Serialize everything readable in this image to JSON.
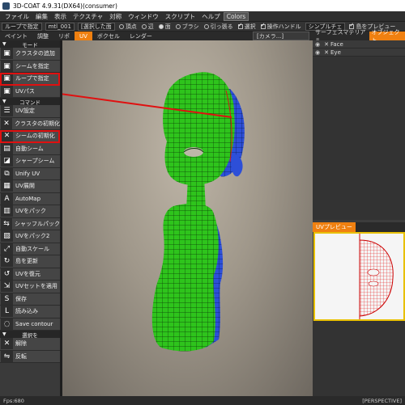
{
  "window": {
    "title": "3D-COAT 4.9.31(DX64)(consumer)"
  },
  "menu": [
    "ファイル",
    "編集",
    "表示",
    "テクスチャ",
    "対称",
    "ウィンドウ",
    "スクリプト",
    "ヘルプ",
    "Colors"
  ],
  "toolbar": {
    "mode_select": "ループで指定",
    "material": "mtl_001",
    "selected_faces": "[選択した面",
    "opt_vertex": "頂点",
    "opt_edge": "辺",
    "opt_face": "面",
    "opt_brush": "ブラシ",
    "opt_pull": "引っ張る",
    "chk_select": "選択",
    "chk_handle": "操作ハンドル",
    "simple": "シンプルチェ",
    "chk_preview": "島をプレビュー"
  },
  "tabs": {
    "paint": "ペイント",
    "sculpt": "調整",
    "retopo": "リポ",
    "uv": "UV",
    "voxel": "ボクセル",
    "render": "レンダー",
    "camera": "[カメラ...]"
  },
  "right_tabs": {
    "surface_material": "サーフェスマテリアル",
    "object": "オブジェクト"
  },
  "layers": [
    {
      "name": "Face"
    },
    {
      "name": "Eye"
    }
  ],
  "left_panel": {
    "mode_header": "モード",
    "command_header": "コマンド",
    "select_header": "選択を",
    "mode_tools": [
      {
        "label": "クラスタの追加",
        "icon": "cube-icon"
      },
      {
        "label": "シームを指定",
        "icon": "cube-icon"
      },
      {
        "label": "ループで指定",
        "icon": "cube-icon",
        "highlight": true
      },
      {
        "label": "UVパス",
        "icon": "cube-icon"
      }
    ],
    "command_tools": [
      {
        "label": "UV設定",
        "icon": "settings-icon"
      },
      {
        "label": "クラスタの初期化",
        "icon": "x-icon"
      },
      {
        "label": "シームの初期化",
        "icon": "x-icon",
        "highlight": true
      },
      {
        "label": "自動シーム",
        "icon": "auto-seam-icon"
      },
      {
        "label": "シャープシーム",
        "icon": "sharp-seam-icon"
      },
      {
        "label": "Unify  UV",
        "icon": "unify-icon"
      },
      {
        "label": "UV展開",
        "icon": "unwrap-icon"
      },
      {
        "label": "AutoMap",
        "icon": "automap-icon"
      },
      {
        "label": "UVをパック",
        "icon": "pack-icon"
      },
      {
        "label": "シャッフルパック",
        "icon": "shuffle-icon"
      },
      {
        "label": "UVをパック2",
        "icon": "pack2-icon"
      },
      {
        "label": "自動スケール",
        "icon": "scale-icon"
      },
      {
        "label": "島を更新",
        "icon": "refresh-icon"
      },
      {
        "label": "UVを復元",
        "icon": "restore-icon"
      },
      {
        "label": "UVセットを適用",
        "icon": "apply-icon"
      },
      {
        "label": "保存",
        "icon": "save-icon"
      },
      {
        "label": "読み込み",
        "icon": "load-icon"
      },
      {
        "label": "Save  contour",
        "icon": "contour-icon"
      }
    ],
    "select_tools": [
      {
        "label": "解除",
        "icon": "x-icon"
      },
      {
        "label": "反転",
        "icon": "invert-icon"
      }
    ]
  },
  "uv_preview": {
    "label": "UVプレビュー"
  },
  "status": {
    "left": "Fps:680",
    "right": "[PERSPECTIVE]"
  },
  "colors": {
    "accent": "#f08010",
    "highlight": "#e01010",
    "mesh_green": "#2ec41c",
    "mesh_blue": "#2d4fd8"
  }
}
